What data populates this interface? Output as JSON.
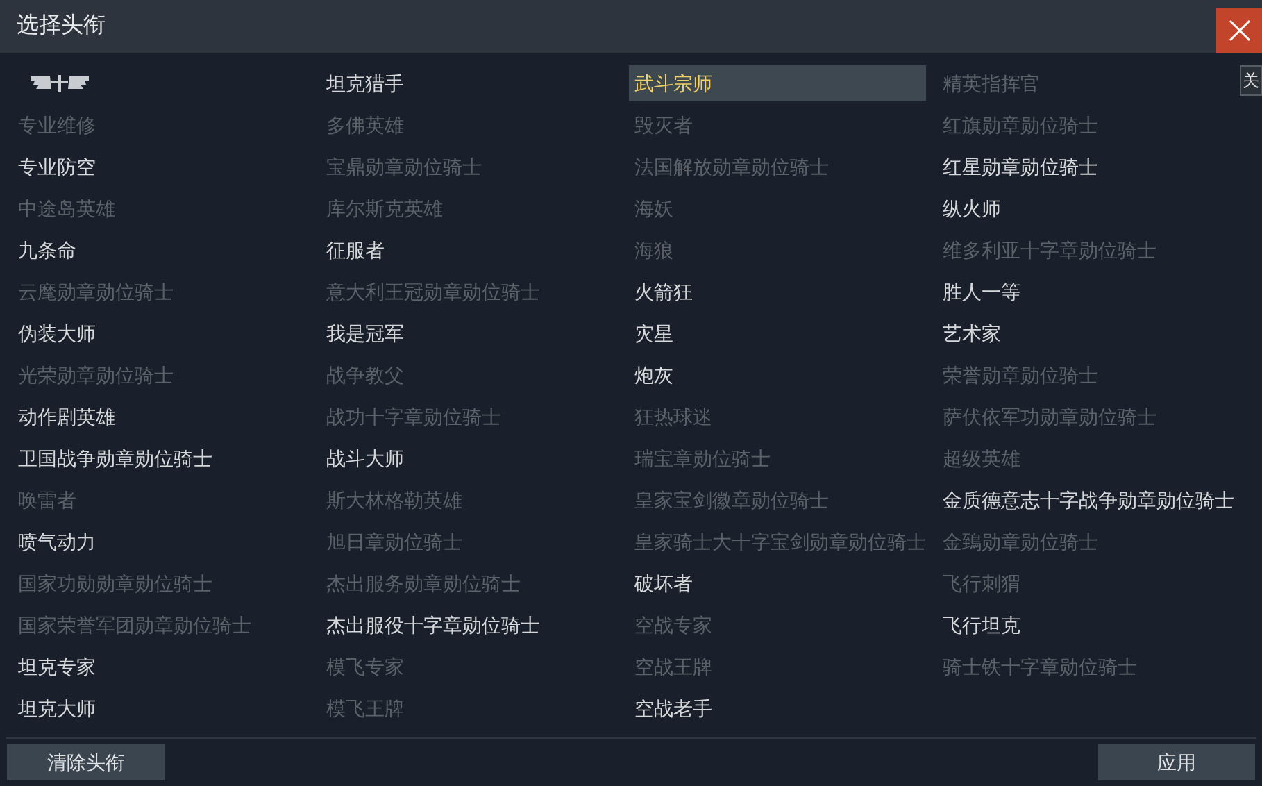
{
  "window": {
    "title": "选择头衔"
  },
  "columns": [
    {
      "items": [
        {
          "kind": "emblem",
          "unlocked": true,
          "selected": false
        },
        {
          "kind": "text",
          "label": "专业维修",
          "unlocked": false,
          "selected": false
        },
        {
          "kind": "text",
          "label": "专业防空",
          "unlocked": true,
          "selected": false
        },
        {
          "kind": "text",
          "label": "中途岛英雄",
          "unlocked": false,
          "selected": false
        },
        {
          "kind": "text",
          "label": "九条命",
          "unlocked": true,
          "selected": false
        },
        {
          "kind": "text",
          "label": "云麾勋章勋位骑士",
          "unlocked": false,
          "selected": false
        },
        {
          "kind": "text",
          "label": "伪装大师",
          "unlocked": true,
          "selected": false
        },
        {
          "kind": "text",
          "label": "光荣勋章勋位骑士",
          "unlocked": false,
          "selected": false
        },
        {
          "kind": "text",
          "label": "动作剧英雄",
          "unlocked": true,
          "selected": false
        },
        {
          "kind": "text",
          "label": "卫国战争勋章勋位骑士",
          "unlocked": true,
          "selected": false
        },
        {
          "kind": "text",
          "label": "唤雷者",
          "unlocked": false,
          "selected": false
        },
        {
          "kind": "text",
          "label": "喷气动力",
          "unlocked": true,
          "selected": false
        },
        {
          "kind": "text",
          "label": "国家功勋勋章勋位骑士",
          "unlocked": false,
          "selected": false
        },
        {
          "kind": "text",
          "label": "国家荣誉军团勋章勋位骑士",
          "unlocked": false,
          "selected": false
        },
        {
          "kind": "text",
          "label": "坦克专家",
          "unlocked": true,
          "selected": false
        },
        {
          "kind": "text",
          "label": "坦克大师",
          "unlocked": true,
          "selected": false
        }
      ]
    },
    {
      "items": [
        {
          "kind": "text",
          "label": "坦克猎手",
          "unlocked": true,
          "selected": false
        },
        {
          "kind": "text",
          "label": "多佛英雄",
          "unlocked": false,
          "selected": false
        },
        {
          "kind": "text",
          "label": "宝鼎勋章勋位骑士",
          "unlocked": false,
          "selected": false
        },
        {
          "kind": "text",
          "label": "库尔斯克英雄",
          "unlocked": false,
          "selected": false
        },
        {
          "kind": "text",
          "label": "征服者",
          "unlocked": true,
          "selected": false
        },
        {
          "kind": "text",
          "label": "意大利王冠勋章勋位骑士",
          "unlocked": false,
          "selected": false
        },
        {
          "kind": "text",
          "label": "我是冠军",
          "unlocked": true,
          "selected": false
        },
        {
          "kind": "text",
          "label": "战争教父",
          "unlocked": false,
          "selected": false
        },
        {
          "kind": "text",
          "label": "战功十字章勋位骑士",
          "unlocked": false,
          "selected": false
        },
        {
          "kind": "text",
          "label": "战斗大师",
          "unlocked": true,
          "selected": false
        },
        {
          "kind": "text",
          "label": "斯大林格勒英雄",
          "unlocked": false,
          "selected": false
        },
        {
          "kind": "text",
          "label": "旭日章勋位骑士",
          "unlocked": false,
          "selected": false
        },
        {
          "kind": "text",
          "label": "杰出服务勋章勋位骑士",
          "unlocked": false,
          "selected": false
        },
        {
          "kind": "text",
          "label": "杰出服役十字章勋位骑士",
          "unlocked": true,
          "selected": false
        },
        {
          "kind": "text",
          "label": "模飞专家",
          "unlocked": false,
          "selected": false
        },
        {
          "kind": "text",
          "label": "模飞王牌",
          "unlocked": false,
          "selected": false
        }
      ]
    },
    {
      "items": [
        {
          "kind": "text",
          "label": "武斗宗师",
          "unlocked": true,
          "selected": true
        },
        {
          "kind": "text",
          "label": "毁灭者",
          "unlocked": false,
          "selected": false
        },
        {
          "kind": "text",
          "label": "法国解放勋章勋位骑士",
          "unlocked": false,
          "selected": false
        },
        {
          "kind": "text",
          "label": "海妖",
          "unlocked": false,
          "selected": false
        },
        {
          "kind": "text",
          "label": "海狼",
          "unlocked": false,
          "selected": false
        },
        {
          "kind": "text",
          "label": "火箭狂",
          "unlocked": true,
          "selected": false
        },
        {
          "kind": "text",
          "label": "灾星",
          "unlocked": true,
          "selected": false
        },
        {
          "kind": "text",
          "label": "炮灰",
          "unlocked": true,
          "selected": false
        },
        {
          "kind": "text",
          "label": "狂热球迷",
          "unlocked": false,
          "selected": false
        },
        {
          "kind": "text",
          "label": "瑞宝章勋位骑士",
          "unlocked": false,
          "selected": false
        },
        {
          "kind": "text",
          "label": "皇家宝剑徽章勋位骑士",
          "unlocked": false,
          "selected": false
        },
        {
          "kind": "text",
          "label": "皇家骑士大十字宝剑勋章勋位骑士",
          "unlocked": false,
          "selected": false
        },
        {
          "kind": "text",
          "label": "破坏者",
          "unlocked": true,
          "selected": false
        },
        {
          "kind": "text",
          "label": "空战专家",
          "unlocked": false,
          "selected": false
        },
        {
          "kind": "text",
          "label": "空战王牌",
          "unlocked": false,
          "selected": false
        },
        {
          "kind": "text",
          "label": "空战老手",
          "unlocked": true,
          "selected": false
        }
      ]
    },
    {
      "items": [
        {
          "kind": "text",
          "label": "精英指挥官",
          "unlocked": false,
          "selected": false
        },
        {
          "kind": "text",
          "label": "红旗勋章勋位骑士",
          "unlocked": false,
          "selected": false
        },
        {
          "kind": "text",
          "label": "红星勋章勋位骑士",
          "unlocked": true,
          "selected": false
        },
        {
          "kind": "text",
          "label": "纵火师",
          "unlocked": true,
          "selected": false
        },
        {
          "kind": "text",
          "label": "维多利亚十字章勋位骑士",
          "unlocked": false,
          "selected": false
        },
        {
          "kind": "text",
          "label": "胜人一等",
          "unlocked": true,
          "selected": false
        },
        {
          "kind": "text",
          "label": "艺术家",
          "unlocked": true,
          "selected": false
        },
        {
          "kind": "text",
          "label": "荣誉勋章勋位骑士",
          "unlocked": false,
          "selected": false
        },
        {
          "kind": "text",
          "label": "萨伏依军功勋章勋位骑士",
          "unlocked": false,
          "selected": false
        },
        {
          "kind": "text",
          "label": "超级英雄",
          "unlocked": false,
          "selected": false
        },
        {
          "kind": "text",
          "label": "金质德意志十字战争勋章勋位骑士",
          "unlocked": true,
          "selected": false
        },
        {
          "kind": "text",
          "label": "金鵄勋章勋位骑士",
          "unlocked": false,
          "selected": false
        },
        {
          "kind": "text",
          "label": "飞行刺猬",
          "unlocked": false,
          "selected": false
        },
        {
          "kind": "text",
          "label": "飞行坦克",
          "unlocked": true,
          "selected": false
        },
        {
          "kind": "text",
          "label": "骑士铁十字章勋位骑士",
          "unlocked": false,
          "selected": false
        }
      ]
    }
  ],
  "tooltip": {
    "text": "关"
  },
  "buttons": {
    "clear": "清除头衔",
    "apply": "应用"
  }
}
